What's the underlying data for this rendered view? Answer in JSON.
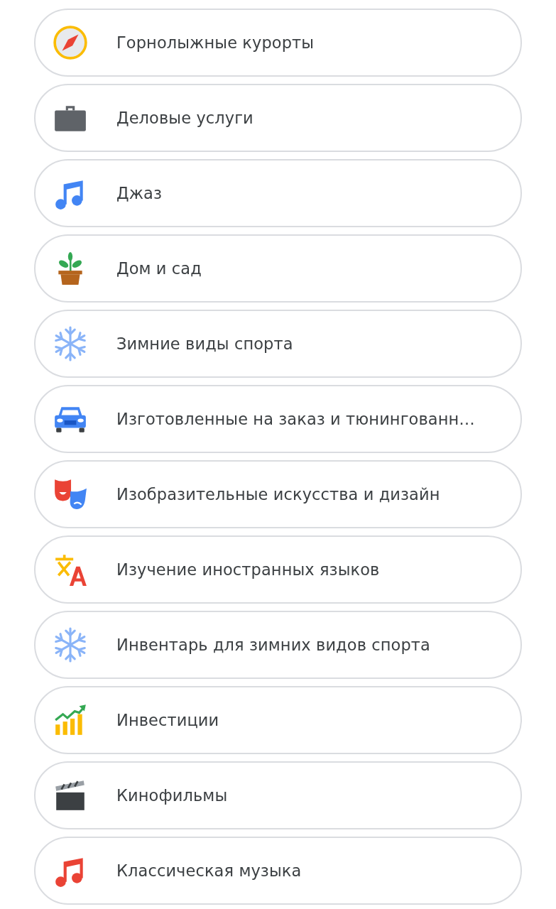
{
  "categories": [
    {
      "label": "Горнолыжные курорты",
      "kind": "compass"
    },
    {
      "label": "Деловые услуги",
      "kind": "briefcase"
    },
    {
      "label": "Джаз",
      "kind": "music",
      "color": "#4285f4"
    },
    {
      "label": "Дом и сад",
      "kind": "plant"
    },
    {
      "label": "Зимние виды спорта",
      "kind": "snowflake"
    },
    {
      "label": "Изготовленные на заказ и тюнингованн…",
      "kind": "car"
    },
    {
      "label": "Изобразительные искусства и дизайн",
      "kind": "masks"
    },
    {
      "label": "Изучение иностранных языков",
      "kind": "translate"
    },
    {
      "label": "Инвентарь для зимних видов спорта",
      "kind": "snowflake"
    },
    {
      "label": "Инвестиции",
      "kind": "chart"
    },
    {
      "label": "Кинофильмы",
      "kind": "clapper"
    },
    {
      "label": "Классическая музыка",
      "kind": "music",
      "color": "#ea4335"
    }
  ]
}
